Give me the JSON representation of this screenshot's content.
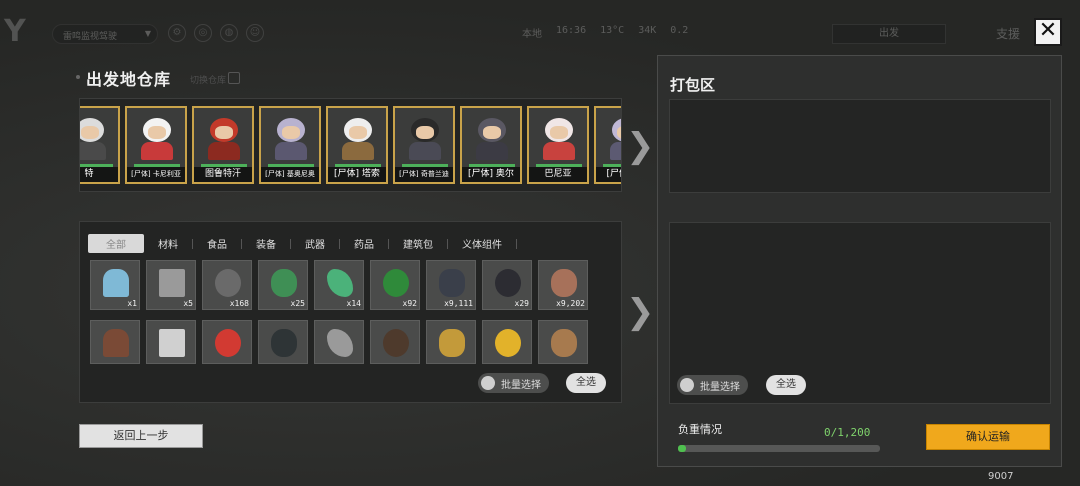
{
  "topbar": {
    "logo": "Y",
    "select_label": "雷鸣监视驾驶",
    "status": [
      "本地",
      "16:36",
      "13°C",
      "34K",
      "0.2"
    ],
    "bar_label": "出发",
    "right_label": "支援"
  },
  "close_label": "✕",
  "warehouse": {
    "title": "出发地仓库",
    "ghost_label": "切换仓库",
    "characters": [
      {
        "name": "特",
        "small": false,
        "hair": "#dcdcdc",
        "coat": "#4a4a4a"
      },
      {
        "name": "[尸体] 卡尼利亚",
        "small": true,
        "hair": "#f3f3f3",
        "coat": "#c83a3a"
      },
      {
        "name": "图鲁特汗",
        "small": false,
        "hair": "#c33a2a",
        "coat": "#8c2a20"
      },
      {
        "name": "[尸体] 基奥尼奥",
        "small": true,
        "hair": "#b8b2cf",
        "coat": "#5b5870"
      },
      {
        "name": "[尸体] 塔索",
        "small": false,
        "hair": "#eeeeee",
        "coat": "#8b6a3e"
      },
      {
        "name": "[尸体] 奇普兰迪",
        "small": true,
        "hair": "#2a2a2a",
        "coat": "#4a4a55"
      },
      {
        "name": "[尸体] 奥尔",
        "small": false,
        "hair": "#5a5863",
        "coat": "#3c3b44"
      },
      {
        "name": "巴尼亚",
        "small": false,
        "hair": "#f0e6e6",
        "coat": "#c8423e"
      },
      {
        "name": "[尸体] 巴",
        "small": false,
        "hair": "#c0b8d6",
        "coat": "#5c5a72"
      }
    ]
  },
  "tabs": [
    "全部",
    "材料",
    "食品",
    "装备",
    "武器",
    "药品",
    "建筑包",
    "义体组件"
  ],
  "items": [
    {
      "icon": "phone-device-icon",
      "qty": "x1",
      "color": "#7fb9d6"
    },
    {
      "icon": "knife-icon",
      "qty": "x5",
      "color": "#9a9a9a"
    },
    {
      "icon": "stone-pile-icon",
      "qty": "x168",
      "color": "#6a6a6a"
    },
    {
      "icon": "green-ore-icon",
      "qty": "x25",
      "color": "#3f8f55"
    },
    {
      "icon": "crystal-icon",
      "qty": "x14",
      "color": "#4bb27a"
    },
    {
      "icon": "herb-pile-icon",
      "qty": "x92",
      "color": "#2f8a3a"
    },
    {
      "icon": "coal-icon",
      "qty": "x9,111",
      "color": "#3a3f4a"
    },
    {
      "icon": "black-ore-icon",
      "qty": "x29",
      "color": "#2c2c32"
    },
    {
      "icon": "copper-ore-icon",
      "qty": "x9,202",
      "color": "#a7715a"
    },
    {
      "icon": "iron-ore-icon",
      "qty": "",
      "color": "#7a4a36"
    },
    {
      "icon": "pipe-icon",
      "qty": "",
      "color": "#d0d0d0"
    },
    {
      "icon": "fuel-can-icon",
      "qty": "",
      "color": "#d23a32"
    },
    {
      "icon": "dark-rock-icon",
      "qty": "",
      "color": "#2e3436"
    },
    {
      "icon": "metal-block-icon",
      "qty": "",
      "color": "#9a9a9a"
    },
    {
      "icon": "mossy-rock-icon",
      "qty": "",
      "color": "#4e3a2c"
    },
    {
      "icon": "gold-crystal-icon",
      "qty": "",
      "color": "#c39a3a"
    },
    {
      "icon": "gold-bar-icon",
      "qty": "",
      "color": "#e2b22a"
    },
    {
      "icon": "wood-plank-icon",
      "qty": "",
      "color": "#a77a4e"
    }
  ],
  "batch_select_label": "批量选择",
  "select_all_label": "全选",
  "back_label": "返回上一步",
  "pack": {
    "title": "打包区",
    "batch_select_label": "批量选择",
    "select_all_label": "全选",
    "load_label": "负重情况",
    "load_value": "0/1,200",
    "load_fraction": 0,
    "confirm_label": "确认运输"
  },
  "footer_number": "9007"
}
